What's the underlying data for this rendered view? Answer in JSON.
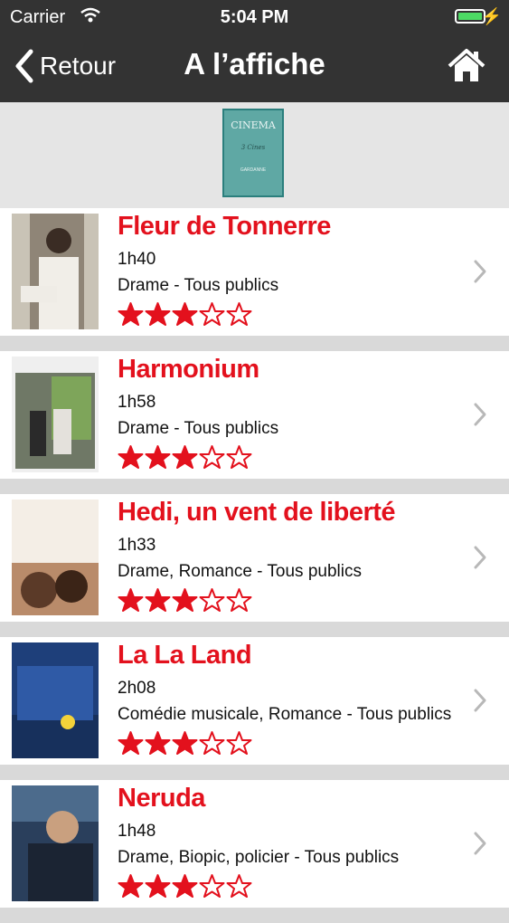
{
  "status": {
    "carrier": "Carrier",
    "time": "5:04 PM"
  },
  "nav": {
    "back_label": "Retour",
    "title": "A l’affiche"
  },
  "logo": {
    "line1": "CINEMA",
    "line2": "3 Cines",
    "line3": "GARDANNE"
  },
  "colors": {
    "header": "#333333",
    "title_red": "#e3111d",
    "star": "#e3111d"
  },
  "movies": [
    {
      "title": "Fleur de Tonnerre",
      "duration": "1h40",
      "genre": "Drame - Tous publics",
      "rating": 3,
      "max_rating": 5
    },
    {
      "title": "Harmonium",
      "duration": "1h58",
      "genre": "Drame - Tous publics",
      "rating": 3,
      "max_rating": 5
    },
    {
      "title": "Hedi, un vent de liberté",
      "duration": "1h33",
      "genre": "Drame, Romance - Tous publics",
      "rating": 3,
      "max_rating": 5
    },
    {
      "title": "La La Land",
      "duration": "2h08",
      "genre": "Comédie musicale, Romance - Tous publics",
      "rating": 3,
      "max_rating": 5
    },
    {
      "title": "Neruda",
      "duration": "1h48",
      "genre": "Drame, Biopic, policier - Tous publics",
      "rating": 3,
      "max_rating": 5
    }
  ]
}
